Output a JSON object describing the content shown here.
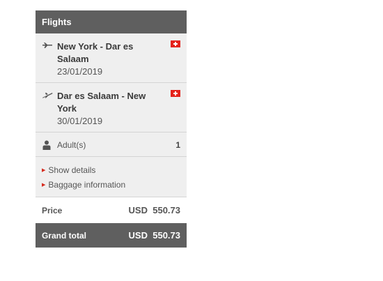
{
  "panel": {
    "title": "Flights",
    "flights": [
      {
        "route": "New York - Dar es Salaam",
        "date": "23/01/2019",
        "icon": "plane-departure-icon"
      },
      {
        "route": "Dar es Salaam - New York",
        "date": "30/01/2019",
        "icon": "plane-arrival-icon"
      }
    ],
    "passengers": {
      "label": "Adult(s)",
      "count": "1"
    },
    "links": {
      "details": "Show details",
      "baggage": "Baggage information"
    },
    "price": {
      "label": "Price",
      "currency": "USD",
      "amount": "550.73"
    },
    "grand_total": {
      "label": "Grand total",
      "currency": "USD",
      "amount": "550.73"
    }
  },
  "colors": {
    "header_bg": "#5f5f5f",
    "section_bg": "#efefef",
    "accent": "#d52b1e"
  }
}
